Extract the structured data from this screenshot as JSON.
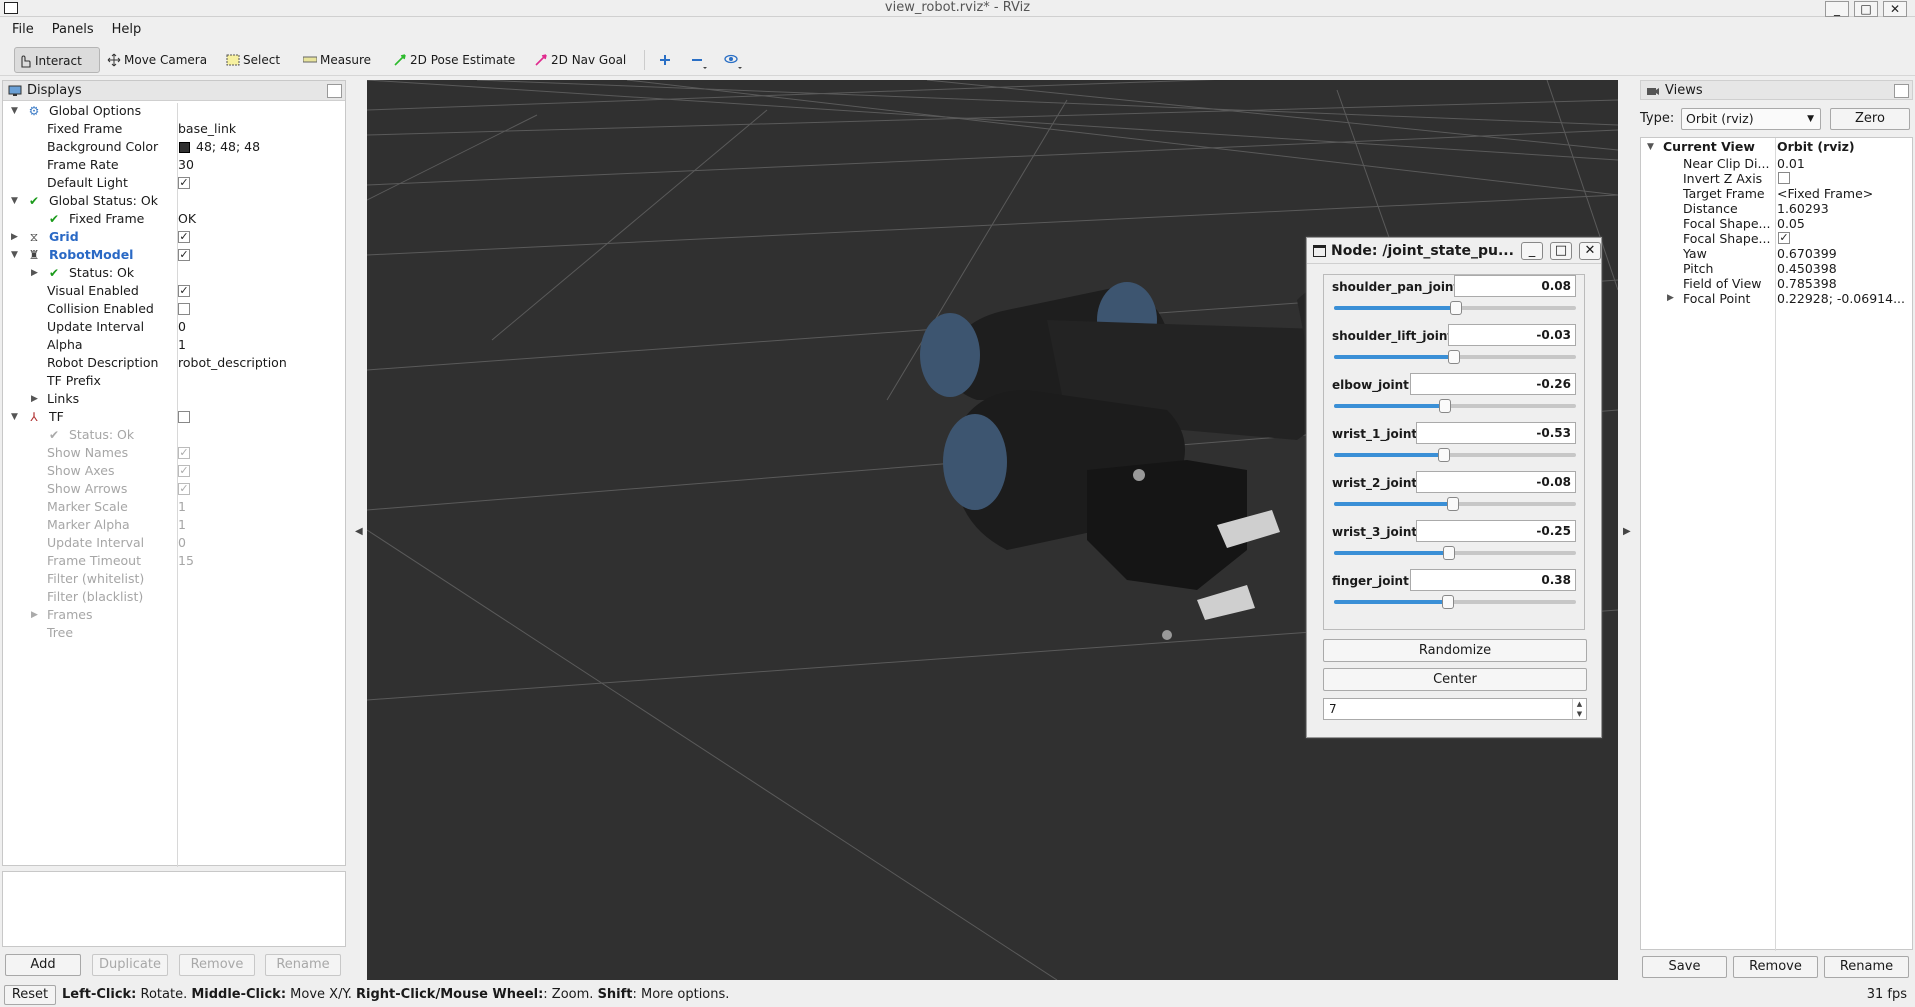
{
  "window": {
    "title": "view_robot.rviz* - RViz",
    "minimize": "_",
    "maximize": "□",
    "close": "✕"
  },
  "menu": [
    "File",
    "Panels",
    "Help"
  ],
  "toolbar": {
    "interact": "Interact",
    "move_camera": "Move Camera",
    "select": "Select",
    "measure": "Measure",
    "pose_estimate": "2D Pose Estimate",
    "nav_goal": "2D Nav Goal"
  },
  "displays": {
    "title": "Displays",
    "rows": {
      "global_options": "Global Options",
      "fixed_frame_k": "Fixed Frame",
      "fixed_frame_v": "base_link",
      "bg_color_k": "Background Color",
      "bg_color_v": "48; 48; 48",
      "frame_rate_k": "Frame Rate",
      "frame_rate_v": "30",
      "default_light_k": "Default Light",
      "global_status": "Global Status: Ok",
      "gs_fixed_frame_k": "Fixed Frame",
      "gs_fixed_frame_v": "OK",
      "grid": "Grid",
      "robot_model": "RobotModel",
      "rm_status": "Status: Ok",
      "visual_enabled": "Visual Enabled",
      "collision_enabled": "Collision Enabled",
      "update_interval_k": "Update Interval",
      "update_interval_v": "0",
      "alpha_k": "Alpha",
      "alpha_v": "1",
      "robot_description_k": "Robot Description",
      "robot_description_v": "robot_description",
      "tf_prefix": "TF Prefix",
      "links": "Links",
      "tf": "TF",
      "tf_status": "Status: Ok",
      "show_names": "Show Names",
      "show_axes": "Show Axes",
      "show_arrows": "Show Arrows",
      "marker_scale_k": "Marker Scale",
      "marker_scale_v": "1",
      "marker_alpha_k": "Marker Alpha",
      "marker_alpha_v": "1",
      "tf_update_interval_k": "Update Interval",
      "tf_update_interval_v": "0",
      "frame_timeout_k": "Frame Timeout",
      "frame_timeout_v": "15",
      "filter_white": "Filter (whitelist)",
      "filter_black": "Filter (blacklist)",
      "frames": "Frames",
      "tree": "Tree"
    },
    "buttons": {
      "add": "Add",
      "duplicate": "Duplicate",
      "remove": "Remove",
      "rename": "Rename"
    }
  },
  "status": {
    "reset": "Reset",
    "left_click": "Left-Click:",
    "rotate": " Rotate. ",
    "middle_click": "Middle-Click:",
    "move": " Move X/Y. ",
    "right_click": "Right-Click/Mouse Wheel:",
    "zoom": ": Zoom. ",
    "shift": "Shift",
    "more": ": More options.",
    "fps": "31 fps"
  },
  "joint_gui": {
    "title": "Node: /joint_state_pu...",
    "joints": [
      {
        "name": "shoulder_pan_joint",
        "value": "0.08",
        "slider": 0.505
      },
      {
        "name": "shoulder_lift_joint",
        "value": "-0.03",
        "slider": 0.495
      },
      {
        "name": "elbow_joint",
        "value": "-0.26",
        "slider": 0.46
      },
      {
        "name": "wrist_1_joint",
        "value": "-0.53",
        "slider": 0.455
      },
      {
        "name": "wrist_2_joint",
        "value": "-0.08",
        "slider": 0.49
      },
      {
        "name": "wrist_3_joint",
        "value": "-0.25",
        "slider": 0.475
      },
      {
        "name": "finger_joint",
        "value": "0.38",
        "slider": 0.47
      }
    ],
    "randomize": "Randomize",
    "center": "Center",
    "spin_value": "7"
  },
  "views": {
    "title": "Views",
    "type_label": "Type:",
    "type_value": "Orbit (rviz)",
    "zero": "Zero",
    "current_view_k": "Current View",
    "current_view_v": "Orbit (rviz)",
    "props": [
      {
        "k": "Near Clip Di...",
        "v": "0.01"
      },
      {
        "k": "Invert Z Axis",
        "v": ""
      },
      {
        "k": "Target Frame",
        "v": "<Fixed Frame>"
      },
      {
        "k": "Distance",
        "v": "1.60293"
      },
      {
        "k": "Focal Shape...",
        "v": "0.05"
      },
      {
        "k": "Focal Shape...",
        "v": ""
      },
      {
        "k": "Yaw",
        "v": "0.670399"
      },
      {
        "k": "Pitch",
        "v": "0.450398"
      },
      {
        "k": "Field of View",
        "v": "0.785398"
      },
      {
        "k": "Focal Point",
        "v": "0.22928; -0.06914..."
      }
    ],
    "buttons": {
      "save": "Save",
      "remove": "Remove",
      "rename": "Rename"
    }
  },
  "colors": {
    "viewport_bg": "#303030",
    "accent": "#3a8fd6",
    "link_blue": "#2a69c5"
  }
}
